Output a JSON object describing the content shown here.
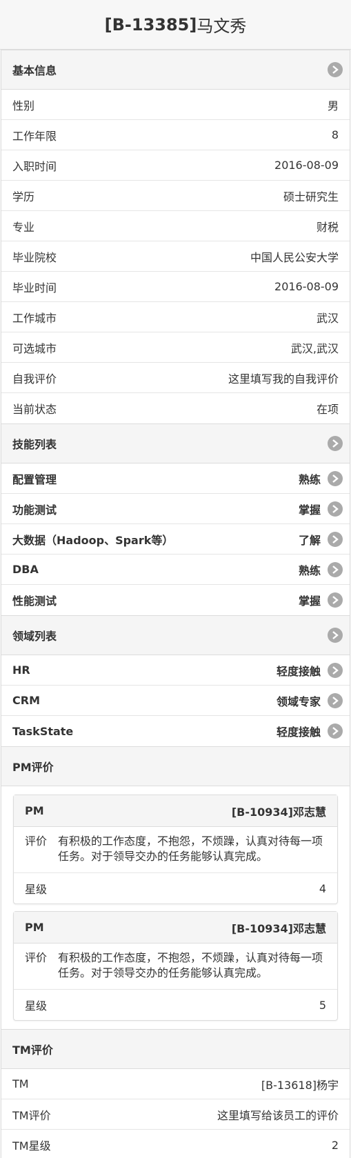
{
  "header": {
    "code": "[B-13385]",
    "name": "马文秀"
  },
  "basic": {
    "title": "基本信息",
    "rows": [
      {
        "label": "性别",
        "value": "男"
      },
      {
        "label": "工作年限",
        "value": "8"
      },
      {
        "label": "入职时间",
        "value": "2016-08-09"
      },
      {
        "label": "学历",
        "value": "硕士研究生"
      },
      {
        "label": "专业",
        "value": "财税"
      },
      {
        "label": "毕业院校",
        "value": "中国人民公安大学"
      },
      {
        "label": "毕业时间",
        "value": "2016-08-09"
      },
      {
        "label": "工作城市",
        "value": "武汉"
      },
      {
        "label": "可选城市",
        "value": "武汉,武汉"
      },
      {
        "label": "自我评价",
        "value": "这里填写我的自我评价"
      },
      {
        "label": "当前状态",
        "value": "在项"
      }
    ]
  },
  "skills": {
    "title": "技能列表",
    "items": [
      {
        "name": "配置管理",
        "level": "熟练"
      },
      {
        "name": "功能测试",
        "level": "掌握"
      },
      {
        "name": "大数据（Hadoop、Spark等）",
        "level": "了解"
      },
      {
        "name": "DBA",
        "level": "熟练"
      },
      {
        "name": "性能测试",
        "level": "掌握"
      }
    ]
  },
  "domains": {
    "title": "领域列表",
    "items": [
      {
        "name": "HR",
        "level": "轻度接触"
      },
      {
        "name": "CRM",
        "level": "领域专家"
      },
      {
        "name": "TaskState",
        "level": "轻度接触"
      }
    ]
  },
  "pm_eval": {
    "title": "PM评价",
    "cards": [
      {
        "role": "PM",
        "person": "[B-10934]邓志慧",
        "comment_label": "评价",
        "comment": "有积极的工作态度，不抱怨，不烦躁，认真对待每一项任务。对于领导交办的任务能够认真完成。",
        "stars_label": "星级",
        "stars": "4"
      },
      {
        "role": "PM",
        "person": "[B-10934]邓志慧",
        "comment_label": "评价",
        "comment": "有积极的工作态度，不抱怨，不烦躁，认真对待每一项任务。对于领导交办的任务能够认真完成。",
        "stars_label": "星级",
        "stars": "5"
      }
    ]
  },
  "tm_eval": {
    "title": "TM评价",
    "rows": [
      {
        "label": "TM",
        "value": "[B-13618]杨宇"
      },
      {
        "label": "TM评价",
        "value": "这里填写给该员工的评价"
      },
      {
        "label": "TM星级",
        "value": "2"
      }
    ]
  },
  "colors": {
    "chevron_bg": "#aaaaaa",
    "header_bg": "#f5f5f5",
    "border": "#dcdcdc"
  },
  "icons": {
    "section_toggle": "chevron-right-icon"
  }
}
